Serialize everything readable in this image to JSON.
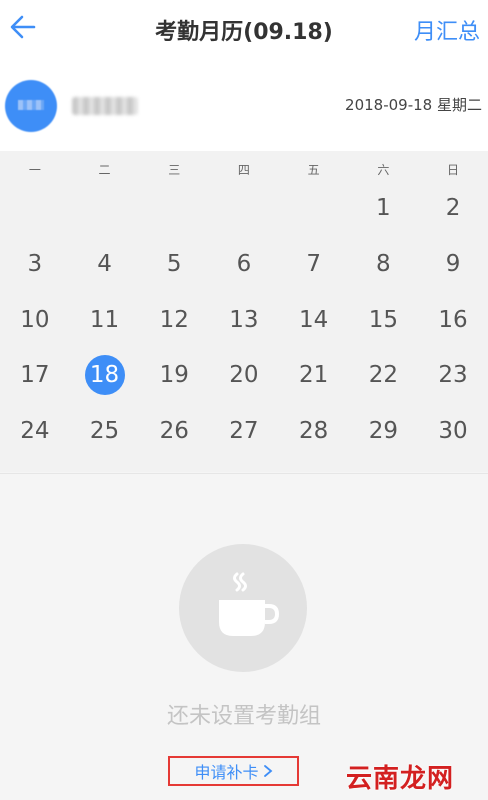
{
  "header": {
    "back_icon": "arrow-left-icon",
    "title": "考勤月历(09.18)",
    "summary_label": "月汇总",
    "accent_color": "#3e8ef7"
  },
  "user": {
    "date_label": "2018-09-18 星期二"
  },
  "calendar": {
    "weekdays": [
      "一",
      "二",
      "三",
      "四",
      "五",
      "六",
      "日"
    ],
    "selected_day": "18",
    "weeks": [
      [
        "",
        "",
        "",
        "",
        "",
        "1",
        "2"
      ],
      [
        "3",
        "4",
        "5",
        "6",
        "7",
        "8",
        "9"
      ],
      [
        "10",
        "11",
        "12",
        "13",
        "14",
        "15",
        "16"
      ],
      [
        "17",
        "18",
        "19",
        "20",
        "21",
        "22",
        "23"
      ],
      [
        "24",
        "25",
        "26",
        "27",
        "28",
        "29",
        "30"
      ]
    ]
  },
  "empty_state": {
    "icon": "coffee-cup-icon",
    "message": "还未设置考勤组",
    "apply_label": "申请补卡",
    "apply_icon": "chevron-right-icon"
  },
  "watermark": {
    "text": "云南龙网"
  }
}
